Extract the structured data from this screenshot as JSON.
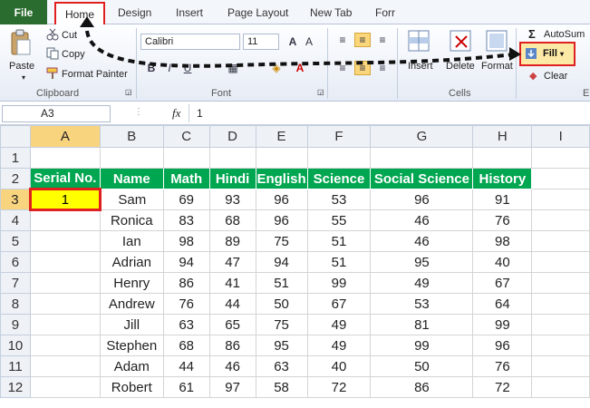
{
  "tabs": [
    "File",
    "Home",
    "Design",
    "Insert",
    "Page Layout",
    "New Tab",
    "Forr"
  ],
  "clipboard": {
    "paste": "Paste",
    "cut": "Cut",
    "copy": "Copy",
    "format_painter": "Format Painter",
    "group": "Clipboard"
  },
  "font": {
    "name": "Calibri",
    "size": "11",
    "group": "Font"
  },
  "cells_group": {
    "insert": "Insert",
    "delete": "Delete",
    "format": "Format",
    "group": "Cells"
  },
  "editing": {
    "autosum": "AutoSum",
    "fill": "Fill",
    "clear": "Clear",
    "group": "E"
  },
  "formula_bar": {
    "name_box": "A3",
    "fx": "fx",
    "value": "1"
  },
  "columns": [
    "A",
    "B",
    "C",
    "D",
    "E",
    "F",
    "G",
    "H",
    "I"
  ],
  "row_numbers": [
    "1",
    "2",
    "3",
    "4",
    "5",
    "6",
    "7",
    "8",
    "9",
    "10",
    "11",
    "12"
  ],
  "headers": [
    "Serial No.",
    "Name",
    "Math",
    "Hindi",
    "English",
    "Science",
    "Social Science",
    "History"
  ],
  "rows": [
    [
      "1",
      "Sam",
      "69",
      "93",
      "96",
      "53",
      "96",
      "91"
    ],
    [
      "",
      "Ronica",
      "83",
      "68",
      "96",
      "55",
      "46",
      "76"
    ],
    [
      "",
      "Ian",
      "98",
      "89",
      "75",
      "51",
      "46",
      "98"
    ],
    [
      "",
      "Adrian",
      "94",
      "47",
      "94",
      "51",
      "95",
      "40"
    ],
    [
      "",
      "Henry",
      "86",
      "41",
      "51",
      "99",
      "49",
      "67"
    ],
    [
      "",
      "Andrew",
      "76",
      "44",
      "50",
      "67",
      "53",
      "64"
    ],
    [
      "",
      "Jill",
      "63",
      "65",
      "75",
      "49",
      "81",
      "99"
    ],
    [
      "",
      "Stephen",
      "68",
      "86",
      "95",
      "49",
      "99",
      "96"
    ],
    [
      "",
      "Adam",
      "44",
      "46",
      "63",
      "40",
      "50",
      "76"
    ],
    [
      "",
      "Robert",
      "61",
      "97",
      "58",
      "72",
      "86",
      "72"
    ]
  ],
  "colors": {
    "header_bg": "#00a650",
    "highlight": "#ffff00",
    "annotation": "#e02020",
    "file_tab": "#2a6c2f"
  }
}
